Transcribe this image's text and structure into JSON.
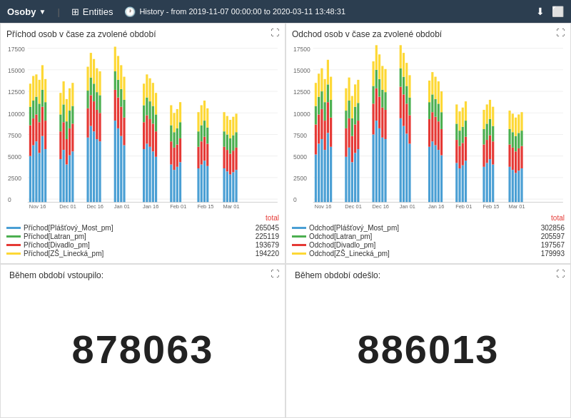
{
  "header": {
    "osoby_label": "Osoby",
    "dropdown_arrow": "▼",
    "entities_icon": "🗂",
    "entities_label": "Entities",
    "history_icon": "🕐",
    "history_label": "History - from 2019-11-07 00:00:00 to 2020-03-11 13:48:31",
    "download_icon": "⬇",
    "fullscreen_icon": "⛶"
  },
  "panels": {
    "prichod": {
      "title": "Příchod osob v čase za zvolené období",
      "total_label": "total",
      "legend": [
        {
          "color": "#4a9fd4",
          "label": "Příchod[Plášťový_Most_pm]",
          "value": "265045"
        },
        {
          "color": "#4caf50",
          "label": "Příchod[Latran_pm]",
          "value": "225119"
        },
        {
          "color": "#e53935",
          "label": "Příchod[Divadlo_pm]",
          "value": "193679"
        },
        {
          "color": "#fdd835",
          "label": "Příchod[ZŠ_Linecká_pm]",
          "value": "194220"
        }
      ]
    },
    "odchod": {
      "title": "Odchod osob v čase za zvolené období",
      "total_label": "total",
      "legend": [
        {
          "color": "#4a9fd4",
          "label": "Odchod[Plášťový_Most_pm]",
          "value": "302856"
        },
        {
          "color": "#4caf50",
          "label": "Odchod[Latran_pm]",
          "value": "205597"
        },
        {
          "color": "#e53935",
          "label": "Odchod[Divadlo_pm]",
          "value": "197567"
        },
        {
          "color": "#fdd835",
          "label": "Odchod[ZŠ_Linecká_pm]",
          "value": "179993"
        }
      ]
    },
    "vstoupilo": {
      "title": "Během období vstoupilo:",
      "value": "878063"
    },
    "odeslo": {
      "title": "Během období odešlo:",
      "value": "886013"
    }
  },
  "x_axis_labels": [
    "Nov 16",
    "Dec 01",
    "Dec 16",
    "Jan 01",
    "Jan 16",
    "Feb 01",
    "Feb 15",
    "Mar 01"
  ]
}
